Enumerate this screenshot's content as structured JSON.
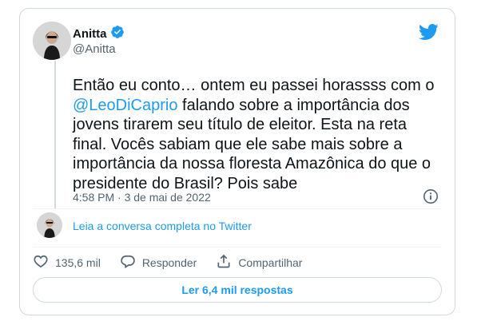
{
  "tweet": {
    "author_name": "Anitta",
    "author_handle": "@Anitta",
    "text_before": "Então eu conto… ontem eu passei horassss com o ",
    "mention": "@LeoDiCaprio",
    "text_after": " falando sobre a importância dos jovens tirarem seu título de eleitor. Esta na reta final. Vocês sabiam que ele sabe mais sobre a importância da nossa floresta Amazônica do que o presidente do Brasil? Pois sabe",
    "timestamp": "4:58 PM · 3 de mai de 2022"
  },
  "conversation_link": "Leia a conversa completa no Twitter",
  "actions": {
    "like_count": "135,6 mil",
    "reply_label": "Responder",
    "share_label": "Compartilhar"
  },
  "replies_button": "Ler 6,4 mil respostas",
  "colors": {
    "accent": "#1d9bf0",
    "secondary_text": "#536471",
    "border": "#cfd9de"
  },
  "icons": [
    "twitter-bird-icon",
    "verified-badge-icon",
    "info-icon",
    "heart-icon",
    "reply-icon",
    "share-icon"
  ]
}
